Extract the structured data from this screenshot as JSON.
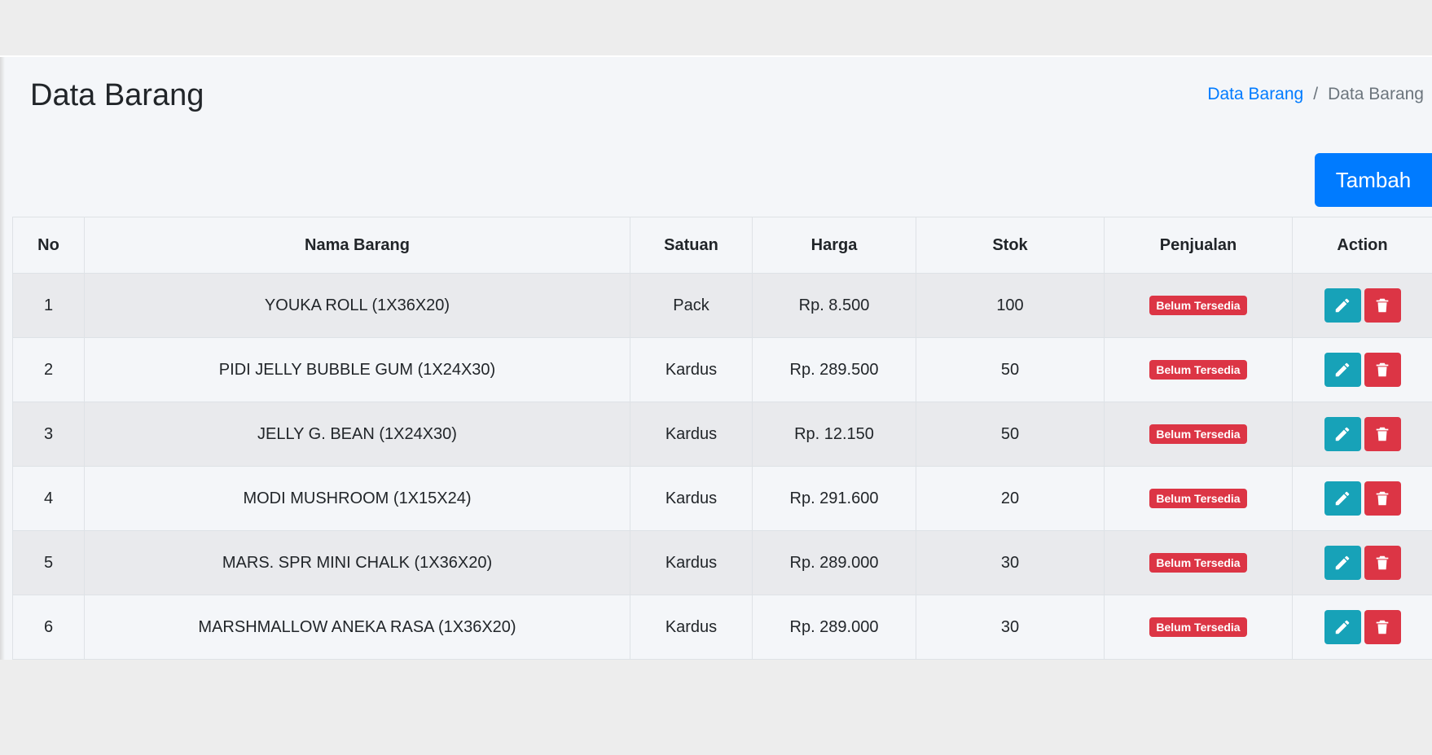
{
  "page": {
    "title": "Data Barang"
  },
  "breadcrumb": {
    "link_label": "Data Barang",
    "separator": "/",
    "current_label": "Data Barang"
  },
  "actions": {
    "add_label": "Tambah"
  },
  "table": {
    "headers": [
      "No",
      "Nama Barang",
      "Satuan",
      "Harga",
      "Stok",
      "Penjualan",
      "Action"
    ],
    "rows": [
      {
        "no": "1",
        "nama": "YOUKA ROLL (1X36X20)",
        "satuan": "Pack",
        "harga": "Rp. 8.500",
        "stok": "100",
        "penjualan": "Belum Tersedia"
      },
      {
        "no": "2",
        "nama": "PIDI JELLY BUBBLE GUM (1X24X30)",
        "satuan": "Kardus",
        "harga": "Rp. 289.500",
        "stok": "50",
        "penjualan": "Belum Tersedia"
      },
      {
        "no": "3",
        "nama": "JELLY G. BEAN (1X24X30)",
        "satuan": "Kardus",
        "harga": "Rp. 12.150",
        "stok": "50",
        "penjualan": "Belum Tersedia"
      },
      {
        "no": "4",
        "nama": "MODI MUSHROOM (1X15X24)",
        "satuan": "Kardus",
        "harga": "Rp. 291.600",
        "stok": "20",
        "penjualan": "Belum Tersedia"
      },
      {
        "no": "5",
        "nama": "MARS. SPR MINI CHALK (1X36X20)",
        "satuan": "Kardus",
        "harga": "Rp. 289.000",
        "stok": "30",
        "penjualan": "Belum Tersedia"
      },
      {
        "no": "6",
        "nama": "MARSHMALLOW ANEKA RASA (1X36X20)",
        "satuan": "Kardus",
        "harga": "Rp. 289.000",
        "stok": "30",
        "penjualan": "Belum Tersedia"
      }
    ]
  },
  "icons": {
    "edit": "pencil-icon",
    "delete": "trash-icon"
  },
  "colors": {
    "primary": "#007bff",
    "info": "#17a2b8",
    "danger": "#dc3545"
  }
}
